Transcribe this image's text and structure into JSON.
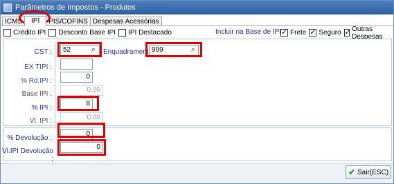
{
  "window": {
    "title": "Parâmetros de Impostos - Produtos"
  },
  "tabs": [
    {
      "label": "ICMS",
      "active": false
    },
    {
      "label": "IPI",
      "active": true
    },
    {
      "label": "PIS/COFINS",
      "active": false
    },
    {
      "label": "Despesas Acessórias",
      "active": false
    }
  ],
  "options": {
    "credito_ipi": {
      "label": "Crédito IPI",
      "checked": false
    },
    "desconto_base_ipi": {
      "label": "Desconto Base IPI",
      "checked": false
    },
    "ipi_destacado": {
      "label": "IPI Destacado",
      "checked": false
    }
  },
  "base_ipi": {
    "label": "Incluir na Base de IPI :",
    "frete": {
      "label": "Frete",
      "checked": true
    },
    "seguro": {
      "label": "Seguro",
      "checked": true
    },
    "outras": {
      "label": "Outras Despesas",
      "checked": true
    }
  },
  "fields": {
    "cst": {
      "label": "CST :",
      "value": "52"
    },
    "enquadramento": {
      "label": "Enquadramento",
      "value": "999"
    },
    "ex_tipi": {
      "label": "EX TIPI :",
      "value": ""
    },
    "rd_ipi": {
      "label": "% Rd.IPI :",
      "value": "0"
    },
    "base_ipi_val": {
      "label": "Base IPI :",
      "value": "0,00"
    },
    "perc_ipi": {
      "label": "% IPI :",
      "value": "8"
    },
    "vl_ipi": {
      "label": "Vl. IPI :",
      "value": "0,00"
    },
    "perc_devolucao": {
      "label": "% Devolução :",
      "value": "0"
    },
    "vl_ipi_devolucao": {
      "label": "Vl.IPI Devolução :",
      "value": "0"
    }
  },
  "footer": {
    "sair_label": "Sair(ESC)"
  },
  "colors": {
    "highlight": "#e00000",
    "label_blue": "#1d2e9c",
    "titlebar": "#3a6cab"
  }
}
